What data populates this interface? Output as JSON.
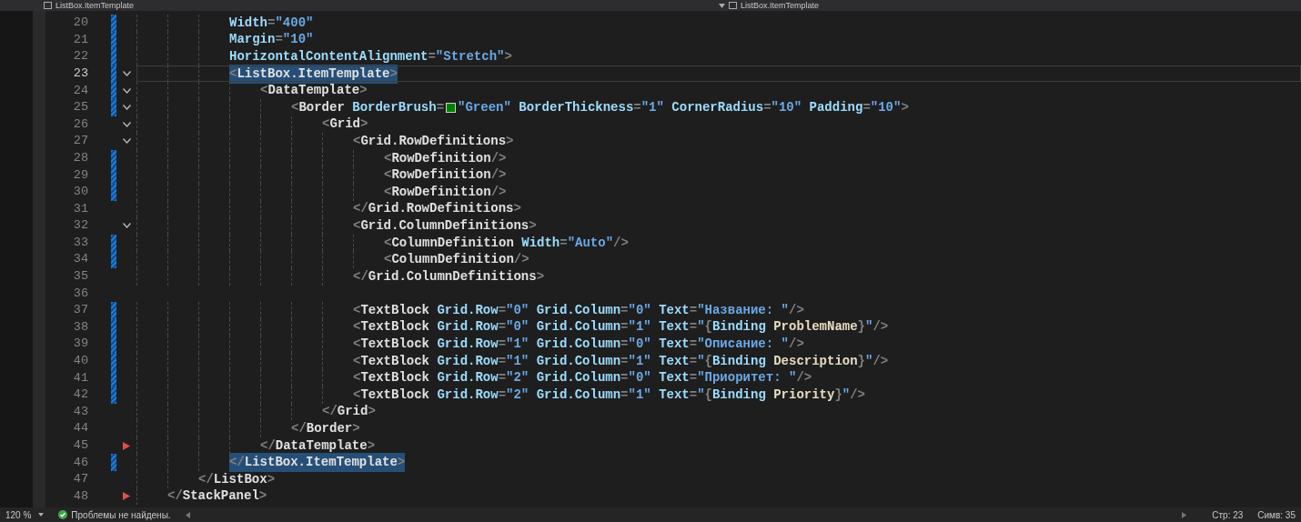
{
  "tabs": [
    {
      "label": "ListBox.ItemTemplate"
    },
    {
      "label": "ListBox.ItemTemplate"
    }
  ],
  "lines": [
    {
      "number": "20",
      "changed": true,
      "fold": false,
      "current": false,
      "selected": false,
      "tokens": [
        {
          "kind": "attr",
          "text": "            Width"
        },
        {
          "kind": "punct",
          "text": "="
        },
        {
          "kind": "value",
          "text": "\"400\""
        }
      ]
    },
    {
      "number": "21",
      "changed": true,
      "fold": false,
      "current": false,
      "selected": false,
      "tokens": [
        {
          "kind": "attr",
          "text": "            Margin"
        },
        {
          "kind": "punct",
          "text": "="
        },
        {
          "kind": "value",
          "text": "\"10\""
        }
      ]
    },
    {
      "number": "22",
      "changed": true,
      "fold": false,
      "current": false,
      "selected": false,
      "tokens": [
        {
          "kind": "attr",
          "text": "            HorizontalContentAlignment"
        },
        {
          "kind": "punct",
          "text": "="
        },
        {
          "kind": "value",
          "text": "\"Stretch\""
        },
        {
          "kind": "punct",
          "text": ">"
        }
      ]
    },
    {
      "number": "23",
      "changed": true,
      "fold": true,
      "current": true,
      "selected": true,
      "tokens": [
        {
          "kind": "punct",
          "text": "            <"
        },
        {
          "kind": "element",
          "text": "ListBox.ItemTemplate"
        },
        {
          "kind": "punct",
          "text": ">"
        }
      ]
    },
    {
      "number": "24",
      "changed": true,
      "fold": true,
      "current": false,
      "selected": false,
      "tokens": [
        {
          "kind": "punct",
          "text": "                <"
        },
        {
          "kind": "element",
          "text": "DataTemplate"
        },
        {
          "kind": "punct",
          "text": ">"
        }
      ]
    },
    {
      "number": "25",
      "changed": true,
      "fold": true,
      "current": false,
      "selected": false,
      "tokens": [
        {
          "kind": "punct",
          "text": "                    <"
        },
        {
          "kind": "element",
          "text": "Border"
        },
        {
          "kind": "attr",
          "text": " BorderBrush"
        },
        {
          "kind": "punct",
          "text": "="
        },
        {
          "kind": "swatch"
        },
        {
          "kind": "value",
          "text": "\"Green\""
        },
        {
          "kind": "attr",
          "text": " BorderThickness"
        },
        {
          "kind": "punct",
          "text": "="
        },
        {
          "kind": "value",
          "text": "\"1\""
        },
        {
          "kind": "attr",
          "text": " CornerRadius"
        },
        {
          "kind": "punct",
          "text": "="
        },
        {
          "kind": "value",
          "text": "\"10\""
        },
        {
          "kind": "attr",
          "text": " Padding"
        },
        {
          "kind": "punct",
          "text": "="
        },
        {
          "kind": "value",
          "text": "\"10\""
        },
        {
          "kind": "punct",
          "text": ">"
        }
      ]
    },
    {
      "number": "26",
      "changed": false,
      "fold": true,
      "current": false,
      "selected": false,
      "tokens": [
        {
          "kind": "punct",
          "text": "                        <"
        },
        {
          "kind": "element",
          "text": "Grid"
        },
        {
          "kind": "punct",
          "text": ">"
        }
      ]
    },
    {
      "number": "27",
      "changed": false,
      "fold": true,
      "current": false,
      "selected": false,
      "tokens": [
        {
          "kind": "punct",
          "text": "                            <"
        },
        {
          "kind": "element",
          "text": "Grid.RowDefinitions"
        },
        {
          "kind": "punct",
          "text": ">"
        }
      ]
    },
    {
      "number": "28",
      "changed": true,
      "fold": false,
      "current": false,
      "selected": false,
      "tokens": [
        {
          "kind": "punct",
          "text": "                                <"
        },
        {
          "kind": "element",
          "text": "RowDefinition"
        },
        {
          "kind": "punct",
          "text": "/>"
        }
      ]
    },
    {
      "number": "29",
      "changed": true,
      "fold": false,
      "current": false,
      "selected": false,
      "tokens": [
        {
          "kind": "punct",
          "text": "                                <"
        },
        {
          "kind": "element",
          "text": "RowDefinition"
        },
        {
          "kind": "punct",
          "text": "/>"
        }
      ]
    },
    {
      "number": "30",
      "changed": true,
      "fold": false,
      "current": false,
      "selected": false,
      "tokens": [
        {
          "kind": "punct",
          "text": "                                <"
        },
        {
          "kind": "element",
          "text": "RowDefinition"
        },
        {
          "kind": "punct",
          "text": "/>"
        }
      ]
    },
    {
      "number": "31",
      "changed": false,
      "fold": false,
      "current": false,
      "selected": false,
      "tokens": [
        {
          "kind": "punct",
          "text": "                            </"
        },
        {
          "kind": "element",
          "text": "Grid.RowDefinitions"
        },
        {
          "kind": "punct",
          "text": ">"
        }
      ]
    },
    {
      "number": "32",
      "changed": false,
      "fold": true,
      "current": false,
      "selected": false,
      "tokens": [
        {
          "kind": "punct",
          "text": "                            <"
        },
        {
          "kind": "element",
          "text": "Grid.ColumnDefinitions"
        },
        {
          "kind": "punct",
          "text": ">"
        }
      ]
    },
    {
      "number": "33",
      "changed": true,
      "fold": false,
      "current": false,
      "selected": false,
      "tokens": [
        {
          "kind": "punct",
          "text": "                                <"
        },
        {
          "kind": "element",
          "text": "ColumnDefinition"
        },
        {
          "kind": "attr",
          "text": " Width"
        },
        {
          "kind": "punct",
          "text": "="
        },
        {
          "kind": "value",
          "text": "\"Auto\""
        },
        {
          "kind": "punct",
          "text": "/>"
        }
      ]
    },
    {
      "number": "34",
      "changed": true,
      "fold": false,
      "current": false,
      "selected": false,
      "tokens": [
        {
          "kind": "punct",
          "text": "                                <"
        },
        {
          "kind": "element",
          "text": "ColumnDefinition"
        },
        {
          "kind": "punct",
          "text": "/>"
        }
      ]
    },
    {
      "number": "35",
      "changed": false,
      "fold": false,
      "current": false,
      "selected": false,
      "tokens": [
        {
          "kind": "punct",
          "text": "                            </"
        },
        {
          "kind": "element",
          "text": "Grid.ColumnDefinitions"
        },
        {
          "kind": "punct",
          "text": ">"
        }
      ]
    },
    {
      "number": "36",
      "changed": false,
      "fold": false,
      "current": false,
      "selected": false
    },
    {
      "number": "37",
      "changed": true,
      "fold": false,
      "current": false,
      "selected": false,
      "tokens": [
        {
          "kind": "punct",
          "text": "                            <"
        },
        {
          "kind": "element",
          "text": "TextBlock"
        },
        {
          "kind": "attr",
          "text": " Grid.Row"
        },
        {
          "kind": "punct",
          "text": "="
        },
        {
          "kind": "value",
          "text": "\"0\""
        },
        {
          "kind": "attr",
          "text": " Grid.Column"
        },
        {
          "kind": "punct",
          "text": "="
        },
        {
          "kind": "value",
          "text": "\"0\""
        },
        {
          "kind": "attr",
          "text": " Text"
        },
        {
          "kind": "punct",
          "text": "="
        },
        {
          "kind": "value",
          "text": "\"Название: \""
        },
        {
          "kind": "punct",
          "text": "/>"
        }
      ]
    },
    {
      "number": "38",
      "changed": true,
      "fold": false,
      "current": false,
      "selected": false,
      "tokens": [
        {
          "kind": "punct",
          "text": "                            <"
        },
        {
          "kind": "element",
          "text": "TextBlock"
        },
        {
          "kind": "attr",
          "text": " Grid.Row"
        },
        {
          "kind": "punct",
          "text": "="
        },
        {
          "kind": "value",
          "text": "\"0\""
        },
        {
          "kind": "attr",
          "text": " Grid.Column"
        },
        {
          "kind": "punct",
          "text": "="
        },
        {
          "kind": "value",
          "text": "\"1\""
        },
        {
          "kind": "attr",
          "text": " Text"
        },
        {
          "kind": "punct",
          "text": "="
        },
        {
          "kind": "value",
          "text": "\""
        },
        {
          "kind": "punct",
          "text": "{"
        },
        {
          "kind": "keyword",
          "text": "Binding"
        },
        {
          "kind": "path",
          "text": " ProblemName"
        },
        {
          "kind": "punct",
          "text": "}"
        },
        {
          "kind": "value",
          "text": "\""
        },
        {
          "kind": "punct",
          "text": "/>"
        }
      ]
    },
    {
      "number": "39",
      "changed": true,
      "fold": false,
      "current": false,
      "selected": false,
      "tokens": [
        {
          "kind": "punct",
          "text": "                            <"
        },
        {
          "kind": "element",
          "text": "TextBlock"
        },
        {
          "kind": "attr",
          "text": " Grid.Row"
        },
        {
          "kind": "punct",
          "text": "="
        },
        {
          "kind": "value",
          "text": "\"1\""
        },
        {
          "kind": "attr",
          "text": " Grid.Column"
        },
        {
          "kind": "punct",
          "text": "="
        },
        {
          "kind": "value",
          "text": "\"0\""
        },
        {
          "kind": "attr",
          "text": " Text"
        },
        {
          "kind": "punct",
          "text": "="
        },
        {
          "kind": "value",
          "text": "\"Описание: \""
        },
        {
          "kind": "punct",
          "text": "/>"
        }
      ]
    },
    {
      "number": "40",
      "changed": true,
      "fold": false,
      "current": false,
      "selected": false,
      "tokens": [
        {
          "kind": "punct",
          "text": "                            <"
        },
        {
          "kind": "element",
          "text": "TextBlock"
        },
        {
          "kind": "attr",
          "text": " Grid.Row"
        },
        {
          "kind": "punct",
          "text": "="
        },
        {
          "kind": "value",
          "text": "\"1\""
        },
        {
          "kind": "attr",
          "text": " Grid.Column"
        },
        {
          "kind": "punct",
          "text": "="
        },
        {
          "kind": "value",
          "text": "\"1\""
        },
        {
          "kind": "attr",
          "text": " Text"
        },
        {
          "kind": "punct",
          "text": "="
        },
        {
          "kind": "value",
          "text": "\""
        },
        {
          "kind": "punct",
          "text": "{"
        },
        {
          "kind": "keyword",
          "text": "Binding"
        },
        {
          "kind": "path",
          "text": " Description"
        },
        {
          "kind": "punct",
          "text": "}"
        },
        {
          "kind": "value",
          "text": "\""
        },
        {
          "kind": "punct",
          "text": "/>"
        }
      ]
    },
    {
      "number": "41",
      "changed": true,
      "fold": false,
      "current": false,
      "selected": false,
      "tokens": [
        {
          "kind": "punct",
          "text": "                            <"
        },
        {
          "kind": "element",
          "text": "TextBlock"
        },
        {
          "kind": "attr",
          "text": " Grid.Row"
        },
        {
          "kind": "punct",
          "text": "="
        },
        {
          "kind": "value",
          "text": "\"2\""
        },
        {
          "kind": "attr",
          "text": " Grid.Column"
        },
        {
          "kind": "punct",
          "text": "="
        },
        {
          "kind": "value",
          "text": "\"0\""
        },
        {
          "kind": "attr",
          "text": " Text"
        },
        {
          "kind": "punct",
          "text": "="
        },
        {
          "kind": "value",
          "text": "\"Приоритет: \""
        },
        {
          "kind": "punct",
          "text": "/>"
        }
      ]
    },
    {
      "number": "42",
      "changed": true,
      "fold": false,
      "current": false,
      "selected": false,
      "tokens": [
        {
          "kind": "punct",
          "text": "                            <"
        },
        {
          "kind": "element",
          "text": "TextBlock"
        },
        {
          "kind": "attr",
          "text": " Grid.Row"
        },
        {
          "kind": "punct",
          "text": "="
        },
        {
          "kind": "value",
          "text": "\"2\""
        },
        {
          "kind": "attr",
          "text": " Grid.Column"
        },
        {
          "kind": "punct",
          "text": "="
        },
        {
          "kind": "value",
          "text": "\"1\""
        },
        {
          "kind": "attr",
          "text": " Text"
        },
        {
          "kind": "punct",
          "text": "="
        },
        {
          "kind": "value",
          "text": "\""
        },
        {
          "kind": "punct",
          "text": "{"
        },
        {
          "kind": "keyword",
          "text": "Binding"
        },
        {
          "kind": "path",
          "text": " Priority"
        },
        {
          "kind": "punct",
          "text": "}"
        },
        {
          "kind": "value",
          "text": "\""
        },
        {
          "kind": "punct",
          "text": "/>"
        }
      ]
    },
    {
      "number": "43",
      "changed": false,
      "fold": false,
      "current": false,
      "selected": false,
      "tokens": [
        {
          "kind": "punct",
          "text": "                        </"
        },
        {
          "kind": "element",
          "text": "Grid"
        },
        {
          "kind": "punct",
          "text": ">"
        }
      ]
    },
    {
      "number": "44",
      "changed": false,
      "fold": false,
      "current": false,
      "selected": false,
      "tokens": [
        {
          "kind": "punct",
          "text": "                    </"
        },
        {
          "kind": "element",
          "text": "Border"
        },
        {
          "kind": "punct",
          "text": ">"
        }
      ]
    },
    {
      "number": "45",
      "changed": false,
      "fold": false,
      "current": false,
      "selected": false,
      "flagged": true,
      "tokens": [
        {
          "kind": "punct",
          "text": "                </"
        },
        {
          "kind": "element",
          "text": "DataTemplate"
        },
        {
          "kind": "punct",
          "text": ">"
        }
      ]
    },
    {
      "number": "46",
      "changed": true,
      "fold": false,
      "current": false,
      "selected": true,
      "tokens": [
        {
          "kind": "punct",
          "text": "            </"
        },
        {
          "kind": "element",
          "text": "ListBox.ItemTemplate"
        },
        {
          "kind": "punct",
          "text": ">"
        }
      ]
    },
    {
      "number": "47",
      "changed": false,
      "fold": false,
      "current": false,
      "selected": false,
      "tokens": [
        {
          "kind": "punct",
          "text": "        </"
        },
        {
          "kind": "element",
          "text": "ListBox"
        },
        {
          "kind": "punct",
          "text": ">"
        }
      ]
    },
    {
      "number": "48",
      "changed": false,
      "fold": false,
      "current": false,
      "selected": false,
      "flagged": true,
      "tokens": [
        {
          "kind": "punct",
          "text": "    </"
        },
        {
          "kind": "element",
          "text": "StackPanel"
        },
        {
          "kind": "punct",
          "text": ">"
        }
      ]
    }
  ],
  "status_bar": {
    "zoom": "120 %",
    "problems": "Проблемы не найдены.",
    "line": "Стр: 23",
    "column": "Симв: 35"
  }
}
